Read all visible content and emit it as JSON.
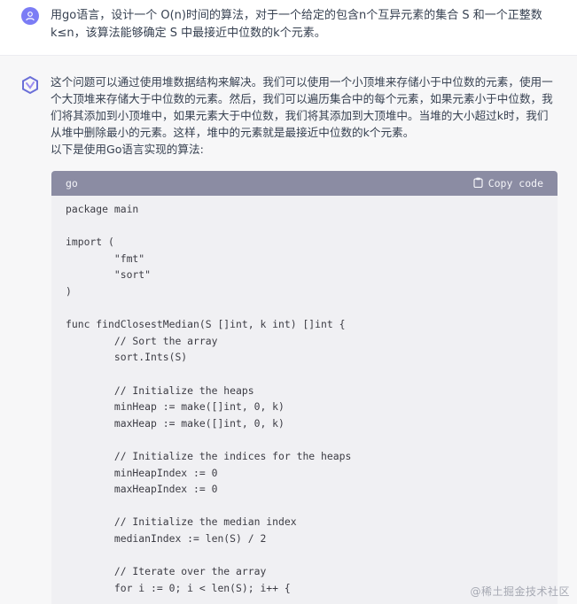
{
  "user": {
    "avatar_icon": "user-icon",
    "message": "用go语言，设计一个 O(n)时间的算法，对于一个给定的包含n个互异元素的集合 S 和一个正整数k≤n，该算法能够确定 S 中最接近中位数的k个元素。"
  },
  "assistant": {
    "avatar_icon": "assistant-logo-icon",
    "paragraph": "这个问题可以通过使用堆数据结构来解决。我们可以使用一个小顶堆来存储小于中位数的元素，使用一个大顶堆来存储大于中位数的元素。然后，我们可以遍历集合中的每个元素，如果元素小于中位数，我们将其添加到小顶堆中，如果元素大于中位数，我们将其添加到大顶堆中。当堆的大小超过k时，我们从堆中删除最小的元素。这样，堆中的元素就是最接近中位数的k个元素。",
    "intro": "以下是使用Go语言实现的算法:"
  },
  "code": {
    "language": "go",
    "copy_label": "Copy code",
    "copy_icon": "clipboard-icon",
    "lines": [
      "package main",
      "",
      "import (",
      "        \"fmt\"",
      "        \"sort\"",
      ")",
      "",
      "func findClosestMedian(S []int, k int) []int {",
      "        // Sort the array",
      "        sort.Ints(S)",
      "",
      "        // Initialize the heaps",
      "        minHeap := make([]int, 0, k)",
      "        maxHeap := make([]int, 0, k)",
      "",
      "        // Initialize the indices for the heaps",
      "        minHeapIndex := 0",
      "        maxHeapIndex := 0",
      "",
      "        // Initialize the median index",
      "        medianIndex := len(S) / 2",
      "",
      "        // Iterate over the array",
      "        for i := 0; i < len(S); i++ {"
    ]
  },
  "watermark": "@稀土掘金技术社区"
}
